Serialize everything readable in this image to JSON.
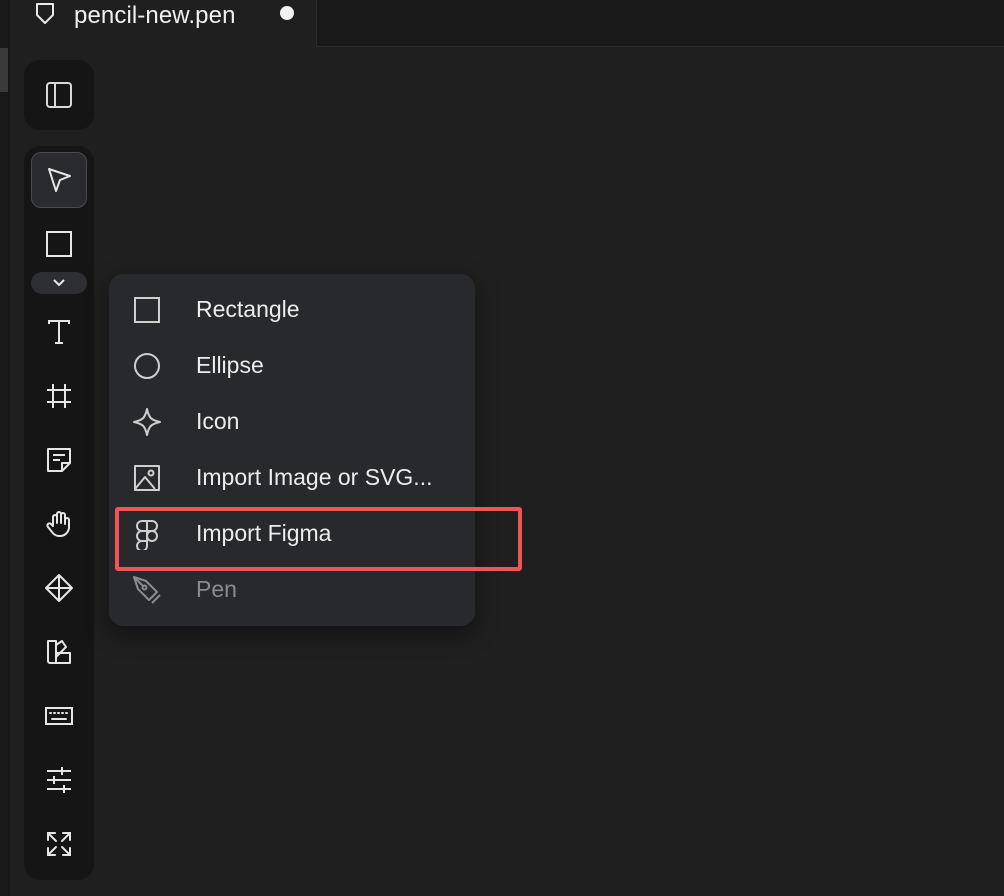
{
  "tab": {
    "title": "pencil-new.pen",
    "icon": "pen-nib-icon",
    "unsaved": true
  },
  "toolbar": {
    "top_tool": "sidebar-toggle-icon",
    "tools": [
      {
        "name": "select",
        "icon": "pointer-arrow-icon",
        "active": true
      },
      {
        "name": "rectangle",
        "icon": "square-icon",
        "active": false
      },
      {
        "name": "expand-shapes",
        "icon": "chevron-down-icon",
        "active": false
      },
      {
        "name": "text",
        "icon": "text-t-icon",
        "active": false
      },
      {
        "name": "frame",
        "icon": "frame-icon",
        "active": false
      },
      {
        "name": "sticky-note",
        "icon": "note-icon",
        "active": false
      },
      {
        "name": "hand",
        "icon": "hand-icon",
        "active": false
      },
      {
        "name": "components",
        "icon": "component-diamond-icon",
        "active": false
      },
      {
        "name": "styles",
        "icon": "swatch-icon",
        "active": false
      },
      {
        "name": "keyboard",
        "icon": "keyboard-icon",
        "active": false
      },
      {
        "name": "settings",
        "icon": "sliders-icon",
        "active": false
      },
      {
        "name": "fullscreen",
        "icon": "expand-arrows-icon",
        "active": false
      }
    ]
  },
  "shape_menu": {
    "items": [
      {
        "label": "Rectangle",
        "icon": "square-icon",
        "disabled": false
      },
      {
        "label": "Ellipse",
        "icon": "circle-icon",
        "disabled": false
      },
      {
        "label": "Icon",
        "icon": "sparkle-icon",
        "disabled": false
      },
      {
        "label": "Import Image or SVG...",
        "icon": "image-icon",
        "disabled": false
      },
      {
        "label": "Import Figma",
        "icon": "figma-icon",
        "disabled": false,
        "highlighted": true
      },
      {
        "label": "Pen",
        "icon": "pen-tool-icon",
        "disabled": true
      }
    ]
  },
  "colors": {
    "background": "#1f1f1f",
    "panel": "#151515",
    "menu": "#28292d",
    "highlight": "#ef5557"
  }
}
